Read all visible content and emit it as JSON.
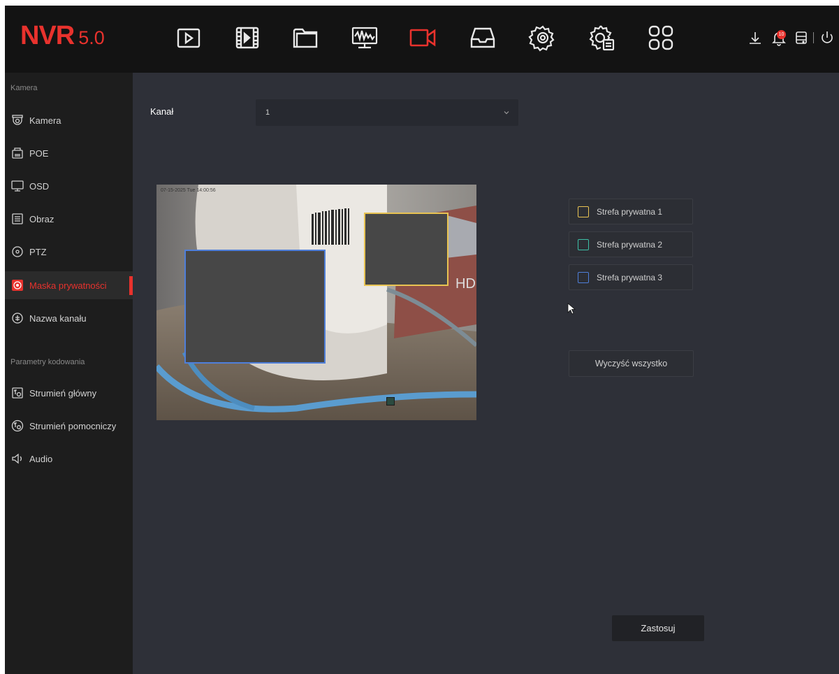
{
  "logo": {
    "brand": "NVR",
    "version": "5.0"
  },
  "topnav": [
    {
      "name": "playback",
      "icon": "play-icon",
      "active": false
    },
    {
      "name": "video-clip",
      "icon": "film-icon",
      "active": false
    },
    {
      "name": "files",
      "icon": "folder-icon",
      "active": false
    },
    {
      "name": "monitor",
      "icon": "monitor-waveform-icon",
      "active": false
    },
    {
      "name": "camera",
      "icon": "camera-icon",
      "active": true
    },
    {
      "name": "storage",
      "icon": "inbox-icon",
      "active": false
    },
    {
      "name": "settings",
      "icon": "gear-icon",
      "active": false
    },
    {
      "name": "system-maintenance",
      "icon": "gear-doc-icon",
      "active": false
    },
    {
      "name": "apps",
      "icon": "grid-icon",
      "active": false
    }
  ],
  "status": {
    "notifications_count": "10"
  },
  "sidebar": {
    "section1": "Kamera",
    "items1": [
      {
        "label": "Kamera",
        "icon": "camera-dome-icon"
      },
      {
        "label": "POE",
        "icon": "poe-icon"
      },
      {
        "label": "OSD",
        "icon": "monitor-icon"
      },
      {
        "label": "Obraz",
        "icon": "image-settings-icon"
      },
      {
        "label": "PTZ",
        "icon": "ptz-icon"
      },
      {
        "label": "Maska prywatności",
        "icon": "privacy-mask-icon",
        "active": true
      },
      {
        "label": "Nazwa kanału",
        "icon": "channel-name-icon"
      }
    ],
    "section2": "Parametry kodowania",
    "items2": [
      {
        "label": "Strumień główny",
        "icon": "main-stream-icon"
      },
      {
        "label": "Strumień pomocniczy",
        "icon": "sub-stream-icon"
      },
      {
        "label": "Audio",
        "icon": "speaker-icon"
      }
    ]
  },
  "channel": {
    "label": "Kanał",
    "value": "1"
  },
  "video": {
    "osd_text": "07-15-2025 Tue 14:00:56",
    "watermark": "HD"
  },
  "zones": [
    {
      "label": "Strefa prywatna 1",
      "color": "#e8c352"
    },
    {
      "label": "Strefa prywatna 2",
      "color": "#3dbfa6"
    },
    {
      "label": "Strefa prywatna 3",
      "color": "#4f7fda"
    }
  ],
  "buttons": {
    "clear_all": "Wyczyść wszystko",
    "apply": "Zastosuj"
  },
  "colors": {
    "accent": "#e8322d",
    "background": "#2e3038",
    "sidebar": "#1d1d1d",
    "topbar": "#131313"
  }
}
